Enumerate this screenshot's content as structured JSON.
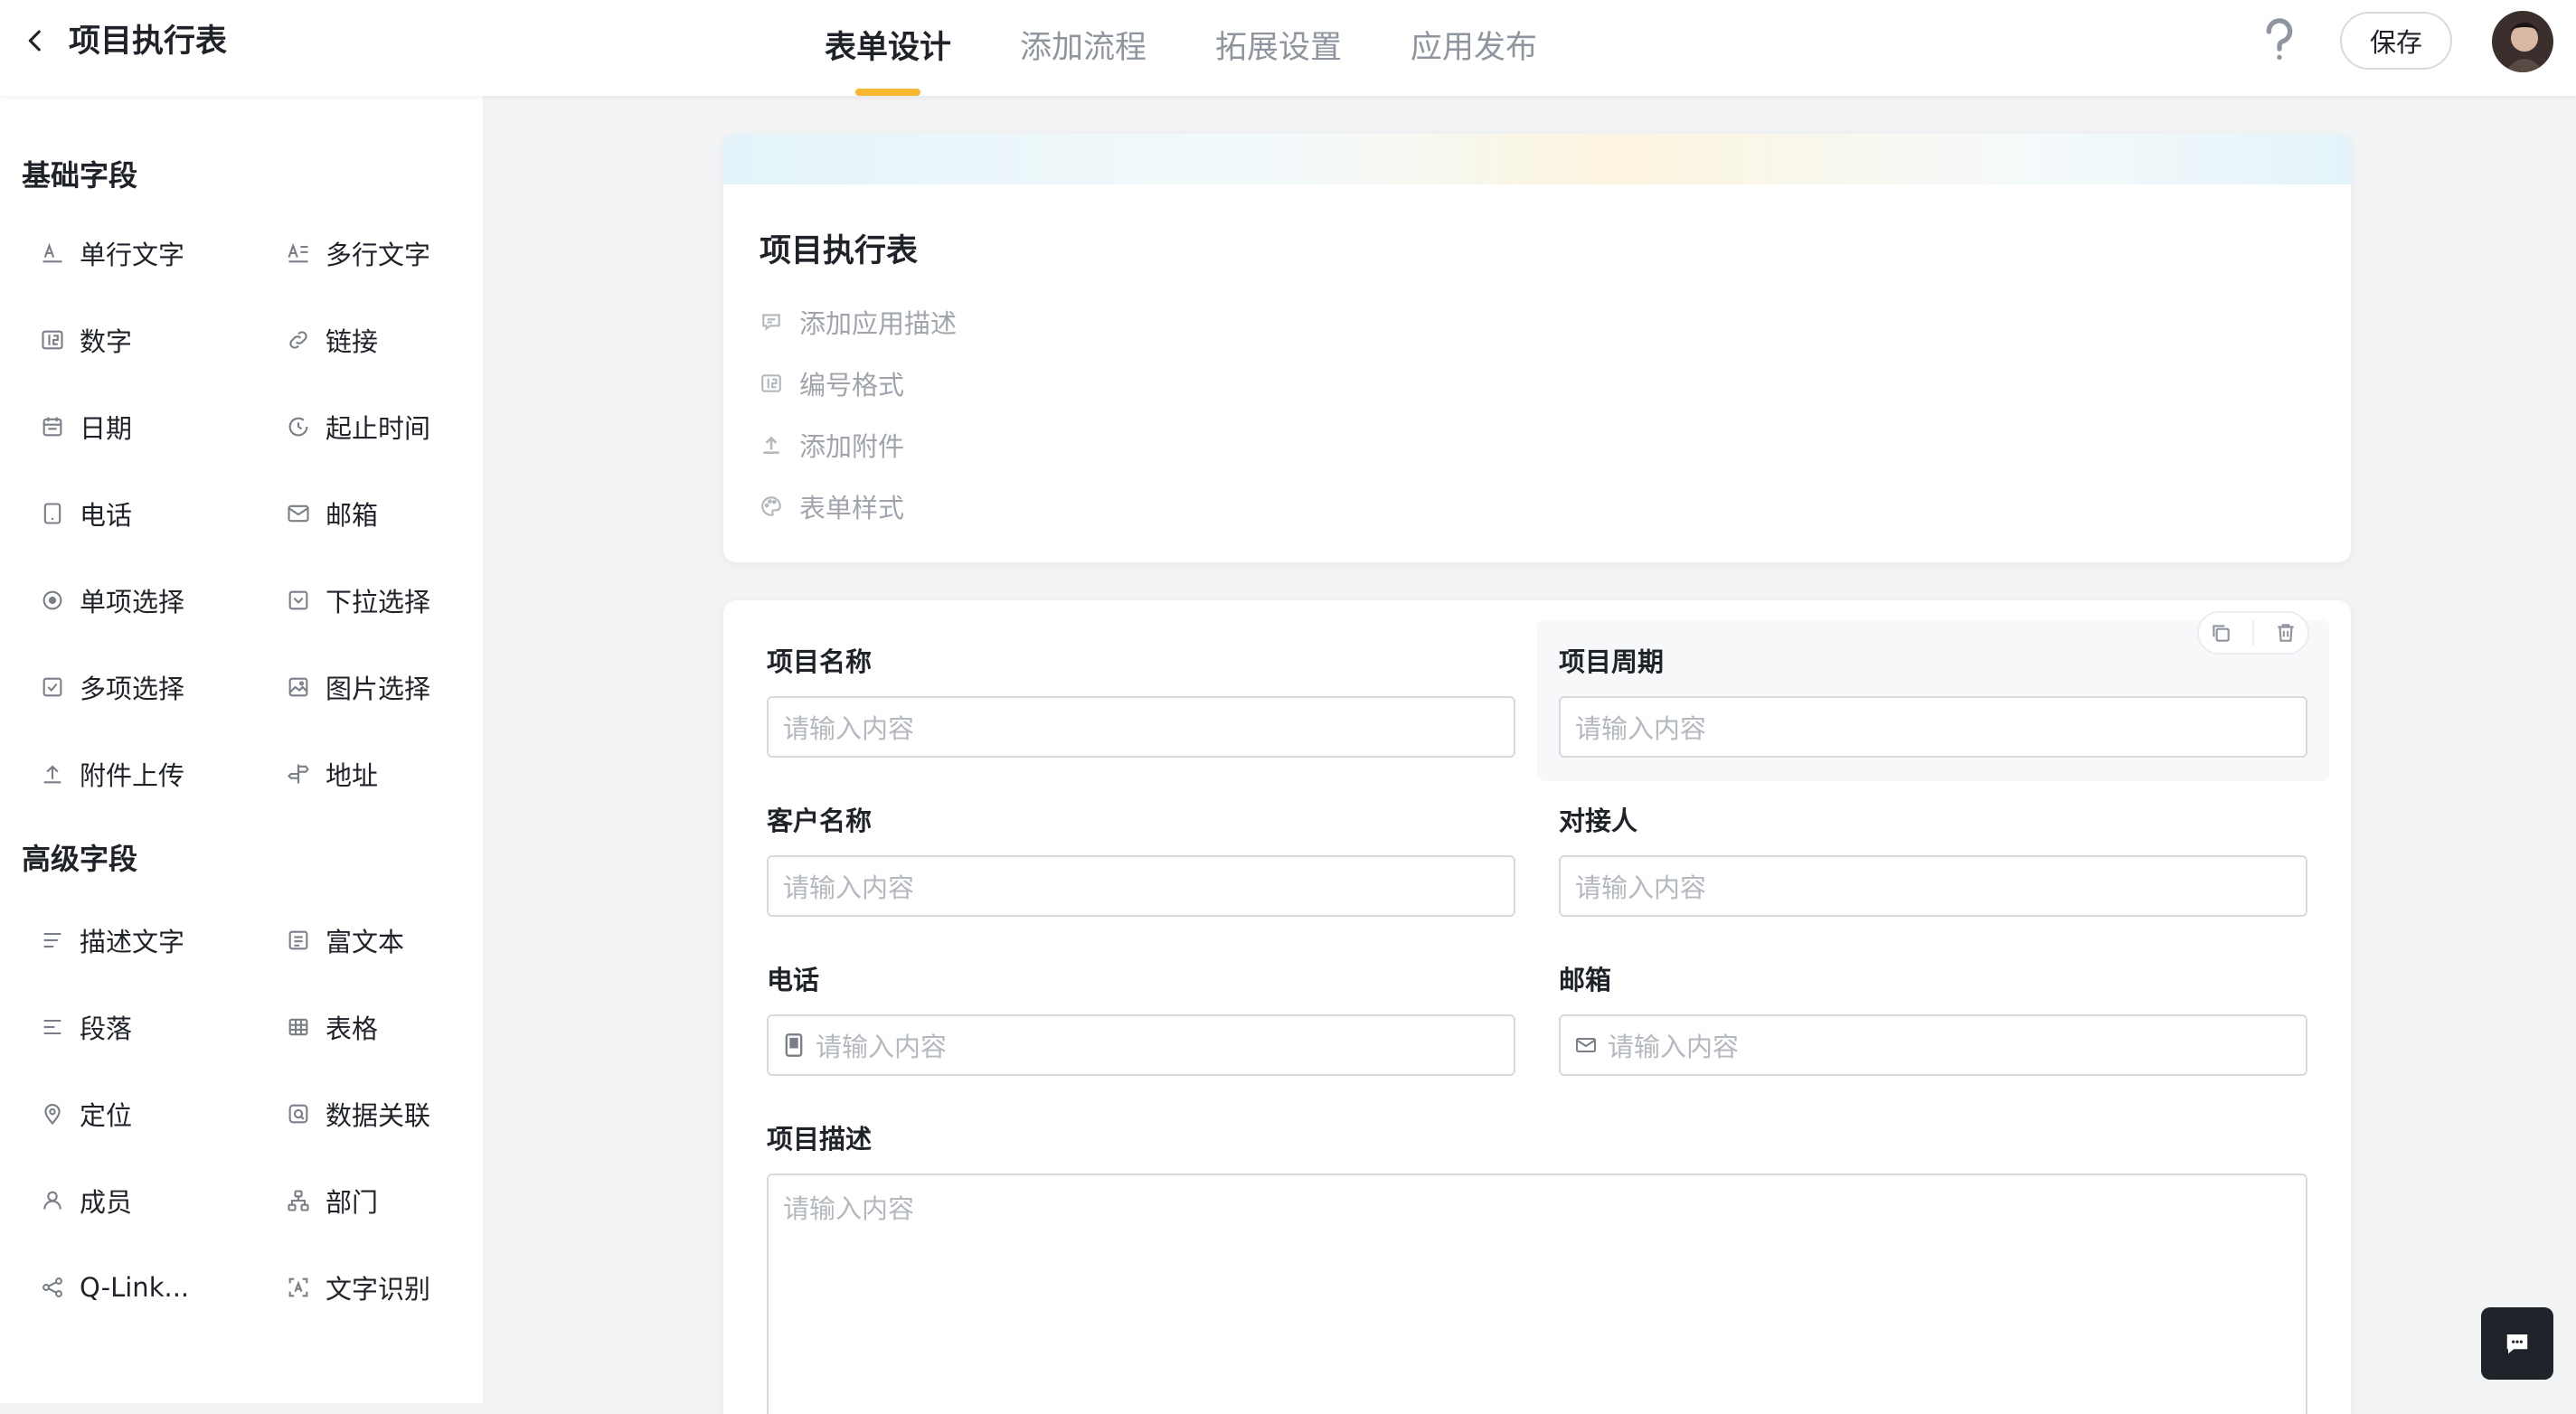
{
  "header": {
    "title": "项目执行表",
    "tabs": [
      {
        "label": "表单设计",
        "active": true
      },
      {
        "label": "添加流程",
        "active": false
      },
      {
        "label": "拓展设置",
        "active": false
      },
      {
        "label": "应用发布",
        "active": false
      }
    ],
    "help_icon": "question-mark-icon",
    "save_label": "保存"
  },
  "sidebar": {
    "basic_title": "基础字段",
    "basic_items": [
      {
        "label": "单行文字",
        "icon": "single-line-text-icon"
      },
      {
        "label": "多行文字",
        "icon": "multi-line-text-icon"
      },
      {
        "label": "数字",
        "icon": "number-icon"
      },
      {
        "label": "链接",
        "icon": "link-icon"
      },
      {
        "label": "日期",
        "icon": "calendar-icon"
      },
      {
        "label": "起止时间",
        "icon": "time-range-icon"
      },
      {
        "label": "电话",
        "icon": "phone-icon"
      },
      {
        "label": "邮箱",
        "icon": "mail-icon"
      },
      {
        "label": "单项选择",
        "icon": "radio-icon"
      },
      {
        "label": "下拉选择",
        "icon": "dropdown-icon"
      },
      {
        "label": "多项选择",
        "icon": "checkbox-icon"
      },
      {
        "label": "图片选择",
        "icon": "image-icon"
      },
      {
        "label": "附件上传",
        "icon": "upload-icon"
      },
      {
        "label": "地址",
        "icon": "signpost-icon"
      }
    ],
    "advanced_title": "高级字段",
    "advanced_items": [
      {
        "label": "描述文字",
        "icon": "description-icon"
      },
      {
        "label": "富文本",
        "icon": "rich-text-icon"
      },
      {
        "label": "段落",
        "icon": "paragraph-icon"
      },
      {
        "label": "表格",
        "icon": "table-icon"
      },
      {
        "label": "定位",
        "icon": "location-pin-icon"
      },
      {
        "label": "数据关联",
        "icon": "data-link-icon"
      },
      {
        "label": "成员",
        "icon": "member-icon"
      },
      {
        "label": "部门",
        "icon": "department-icon"
      },
      {
        "label": "Q-Link...",
        "icon": "share-node-icon"
      },
      {
        "label": "文字识别",
        "icon": "ocr-scan-icon"
      }
    ]
  },
  "form_header": {
    "title": "项目执行表",
    "meta": [
      {
        "label": "添加应用描述",
        "icon": "comment-icon"
      },
      {
        "label": "编号格式",
        "icon": "number-format-icon"
      },
      {
        "label": "添加附件",
        "icon": "upload-icon"
      },
      {
        "label": "表单样式",
        "icon": "palette-icon"
      }
    ]
  },
  "form_fields": [
    {
      "label": "项目名称",
      "placeholder": "请输入内容"
    },
    {
      "label": "项目周期",
      "placeholder": "请输入内容"
    },
    {
      "label": "客户名称",
      "placeholder": "请输入内容"
    },
    {
      "label": "对接人",
      "placeholder": "请输入内容"
    },
    {
      "label": "电话",
      "placeholder": "请输入内容",
      "icon": "phone-icon"
    },
    {
      "label": "邮箱",
      "placeholder": "请输入内容",
      "icon": "mail-icon"
    },
    {
      "label": "项目描述",
      "placeholder": "请输入内容"
    }
  ],
  "colors": {
    "accent": "#f7b731",
    "text": "#1f2329",
    "muted": "#8f959e",
    "background": "#f2f3f5"
  }
}
